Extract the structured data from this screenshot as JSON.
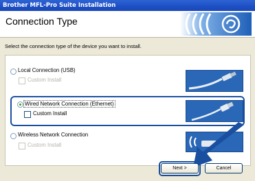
{
  "window": {
    "title": "Brother MFL-Pro Suite Installation"
  },
  "header": {
    "title": "Connection Type",
    "logo_icon": "network-waves-icon"
  },
  "instruction": "Select the connection type of the device you want to install.",
  "options": [
    {
      "label": "Local Connection (USB)",
      "selected": false,
      "custom_install_label": "Custom Install",
      "custom_install_enabled": false,
      "image_icon": "usb-cable-icon"
    },
    {
      "label": "Wired Network Connection (Ethernet)",
      "selected": true,
      "custom_install_label": "Custom Install",
      "custom_install_enabled": true,
      "image_icon": "ethernet-cable-icon"
    },
    {
      "label": "Wireless Network Connection",
      "selected": false,
      "custom_install_label": "Custom Install",
      "custom_install_enabled": false,
      "image_icon": "wireless-router-icon"
    }
  ],
  "buttons": {
    "next_label": "Next >",
    "cancel_label": "Cancel"
  },
  "colors": {
    "title_bar": "#1c4fc4",
    "highlight": "#1a4fa0",
    "selected_radio": "#3a9b2a"
  }
}
